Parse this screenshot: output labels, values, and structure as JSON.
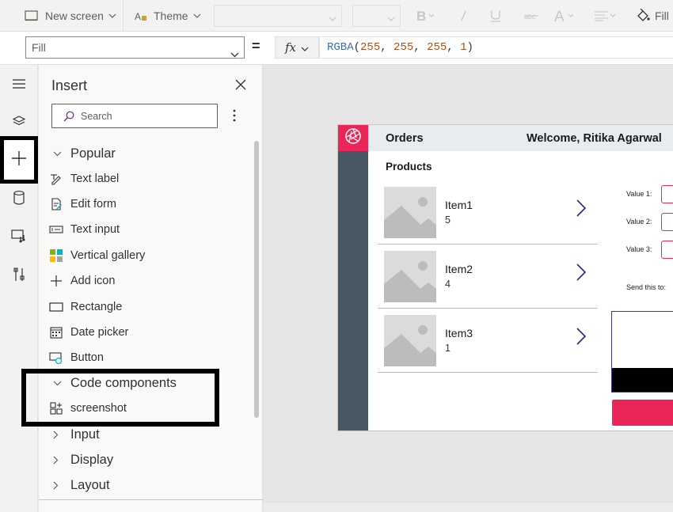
{
  "toolbar": {
    "new_screen_label": "New screen",
    "theme_label": "Theme",
    "fill_label": "Fill",
    "font_select_value": "",
    "size_select_value": ""
  },
  "formula_bar": {
    "property": "Fill",
    "equals": "=",
    "fx_label": "fx",
    "formula_fn": "RGBA",
    "formula_open": "(",
    "formula_args": [
      "255",
      "255",
      "255",
      "1"
    ],
    "formula_comma": ", ",
    "formula_close": ")"
  },
  "left_rail": {
    "items": [
      "menu-icon",
      "tree-view-icon",
      "insert-icon",
      "data-icon",
      "media-icon",
      "advanced-tools-icon"
    ],
    "active": "insert-icon"
  },
  "insert_pane": {
    "title": "Insert",
    "search_placeholder": "Search",
    "popular": {
      "label": "Popular",
      "items": [
        {
          "label": "Text label",
          "icon": "text-label-icon"
        },
        {
          "label": "Edit form",
          "icon": "edit-form-icon"
        },
        {
          "label": "Text input",
          "icon": "text-input-icon"
        },
        {
          "label": "Vertical gallery",
          "icon": "vertical-gallery-icon"
        },
        {
          "label": "Add icon",
          "icon": "add-icon"
        },
        {
          "label": "Rectangle",
          "icon": "rectangle-icon"
        },
        {
          "label": "Date picker",
          "icon": "date-picker-icon"
        },
        {
          "label": "Button",
          "icon": "button-icon"
        }
      ]
    },
    "code_components": {
      "label": "Code components",
      "items": [
        {
          "label": "screenshot",
          "icon": "code-component-icon"
        }
      ]
    },
    "collapsed_groups": [
      "Input",
      "Display",
      "Layout"
    ]
  },
  "app_preview": {
    "title": "Orders",
    "welcome": "Welcome, Ritika Agarwal",
    "products_label": "Products",
    "items": [
      {
        "name": "Item1",
        "value": "5"
      },
      {
        "name": "Item2",
        "value": "4"
      },
      {
        "name": "Item3",
        "value": "1"
      }
    ],
    "value_labels": [
      "Value 1:",
      "Value 2:",
      "Value 3:"
    ],
    "send_label": "Send this to:",
    "accent_color": "#ea2557",
    "sidebar_color": "#485863"
  }
}
